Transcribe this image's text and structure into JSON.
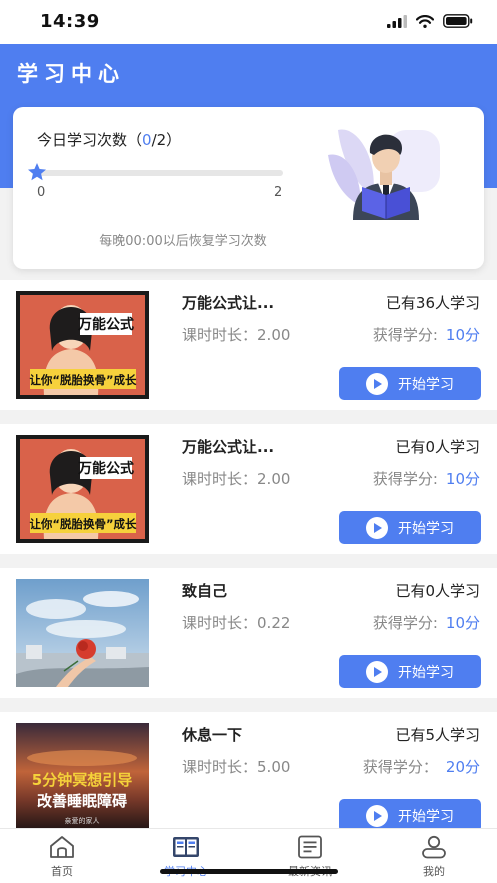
{
  "status_bar": {
    "time": "14:39"
  },
  "header": {
    "title": "学习中心"
  },
  "study_card": {
    "label": "今日学习次数（",
    "current": "0",
    "separator": "/2）",
    "progress": 0,
    "min_label": "0",
    "max_label": "2",
    "note": "每晚00:00以后恢复学习次数"
  },
  "courses": [
    {
      "title": "万能公式让...",
      "learners": "已有36人学习",
      "duration_label": "课时时长：",
      "duration": "2.00",
      "credit_label": "获得学分:",
      "credit": "10分",
      "button": "开始学习",
      "thumb_text_1": "万能公式",
      "thumb_text_2": "让你“脱胎换骨”成长"
    },
    {
      "title": "万能公式让...",
      "learners": "已有0人学习",
      "duration_label": "课时时长：",
      "duration": "2.00",
      "credit_label": "获得学分:",
      "credit": "10分",
      "button": "开始学习",
      "thumb_text_1": "万能公式",
      "thumb_text_2": "让你“脱胎换骨”成长"
    },
    {
      "title": "致自己",
      "learners": "已有0人学习",
      "duration_label": "课时时长：",
      "duration": "0.22",
      "credit_label": "获得学分:",
      "credit": "10分",
      "button": "开始学习"
    },
    {
      "title": "休息一下",
      "learners": "已有5人学习",
      "duration_label": "课时时长：",
      "duration": "5.00",
      "credit_label": "获得学分：",
      "credit": "20分",
      "button": "开始学习",
      "thumb_text_1": "5分钟冥想引导",
      "thumb_text_2": "改善睡眠障碍",
      "thumb_text_3": "亲爱的家人"
    }
  ],
  "tabs": [
    {
      "label": "首页",
      "icon": "home-icon"
    },
    {
      "label": "学习中心",
      "icon": "book-icon"
    },
    {
      "label": "最新资讯",
      "icon": "news-icon"
    },
    {
      "label": "我的",
      "icon": "user-icon"
    }
  ],
  "colors": {
    "accent": "#4f7ef0",
    "background": "#f2f2f2"
  }
}
